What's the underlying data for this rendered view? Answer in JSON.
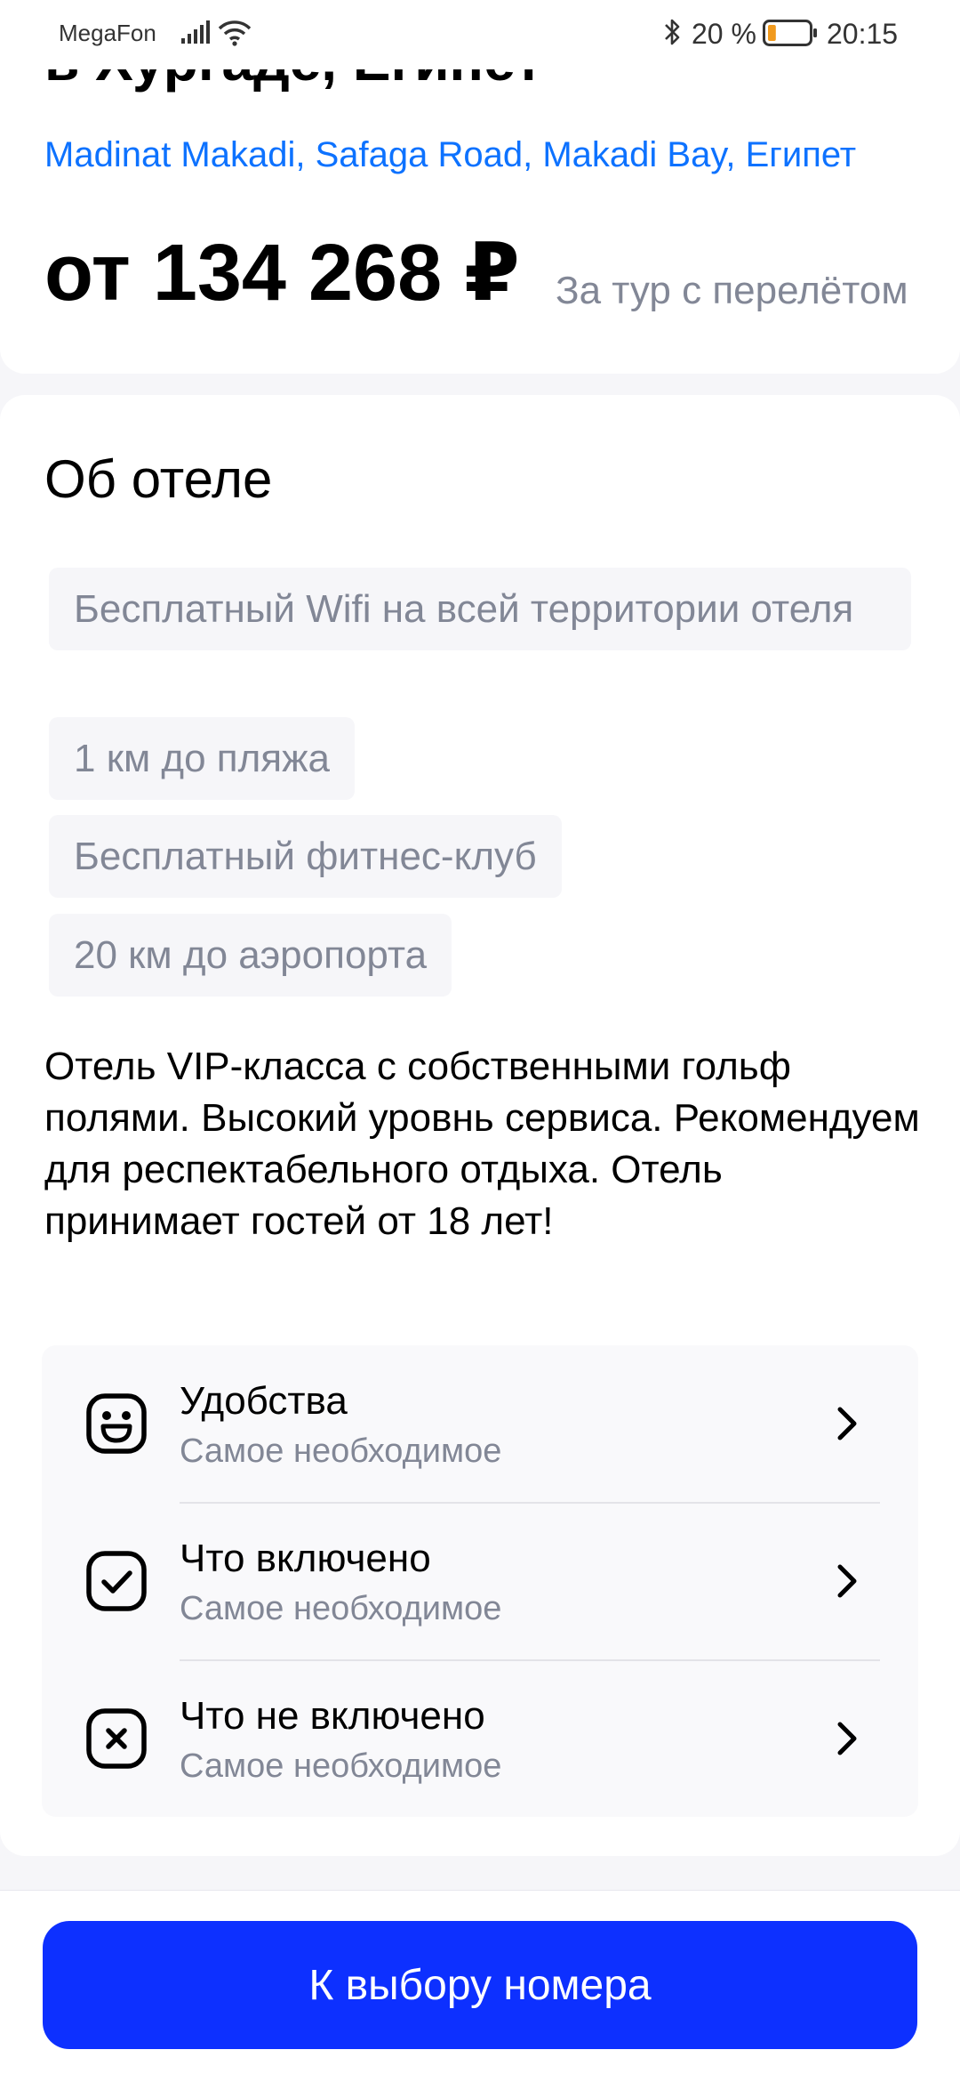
{
  "status_bar": {
    "carrier": "MegaFon",
    "battery_percent": "20 %",
    "battery_level": 0.2,
    "time": "20:15"
  },
  "header": {
    "title": "в Хургаде, Египет",
    "address": "Madinat Makadi, Safaga Road, Makadi Bay, Египет",
    "price": "от 134 268 ₽",
    "price_note": "За тур с перелётом"
  },
  "about": {
    "title": "Об отеле",
    "features": [
      "Бесплатный Wifi на всей территории отеля",
      "1 км до пляжа",
      "Бесплатный фитнес-клуб",
      "20 км до аэропорта"
    ],
    "description": "Отель VIP-класса с собственными гольф полями. Высокий уровнь сервиса. Рекомендуем для респектабельного отдыха. Отель принимает гостей от 18 лет!",
    "info_items": [
      {
        "title": "Удобства",
        "subtitle": "Самое необходимое",
        "icon": "emoji-happy-icon"
      },
      {
        "title": "Что включено",
        "subtitle": "Самое необходимое",
        "icon": "tick-square-icon"
      },
      {
        "title": "Что не включено",
        "subtitle": "Самое необходимое",
        "icon": "close-square-icon"
      }
    ]
  },
  "actions": {
    "choose_room": "К выбору номера"
  },
  "colors": {
    "accent": "#0D30FF",
    "link": "#0D72FF",
    "muted_text": "#828796",
    "chip_bg": "#F6F6F9",
    "page_bg": "#F6F6F9"
  }
}
